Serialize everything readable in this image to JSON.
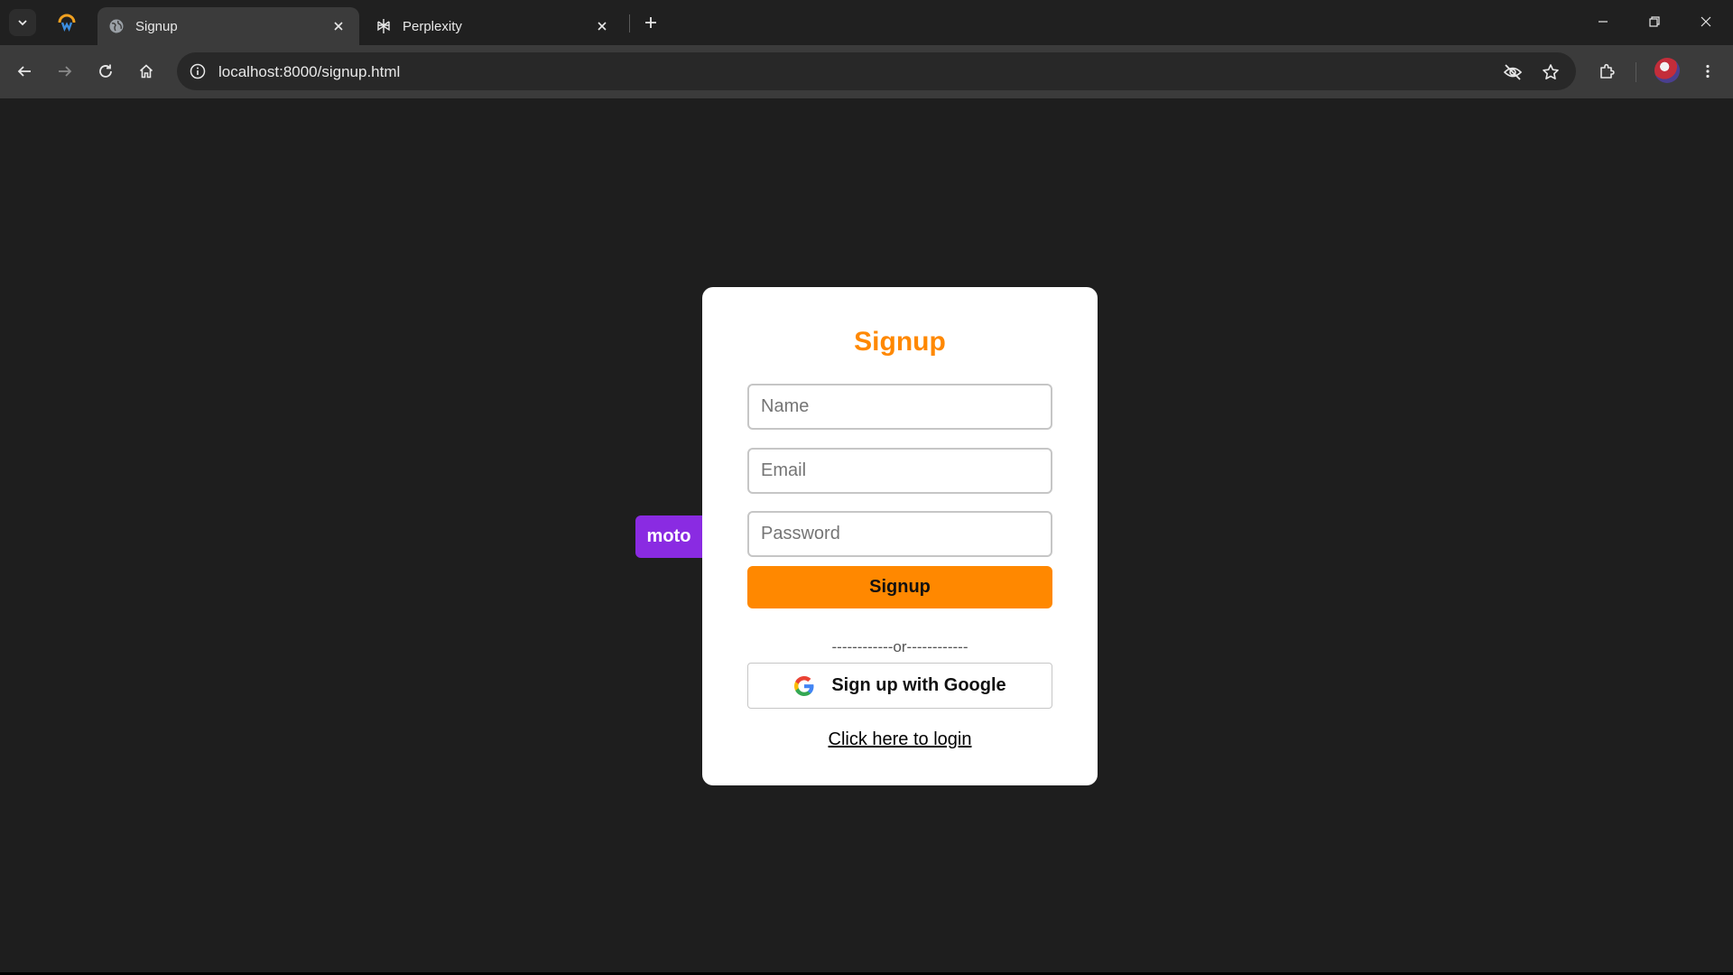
{
  "browser": {
    "tabs": [
      {
        "title": "Signup",
        "active": true
      },
      {
        "title": "Perplexity",
        "active": false
      }
    ],
    "url": "localhost:8000/signup.html"
  },
  "signup": {
    "title": "Signup",
    "name_placeholder": "Name",
    "email_placeholder": "Email",
    "password_placeholder": "Password",
    "submit_label": "Signup",
    "divider": "------------or------------",
    "google_label": "Sign up with Google",
    "login_link": "Click here to login"
  },
  "badge": {
    "label": "moto",
    "color": "#8a2be2"
  },
  "colors": {
    "accent": "#ff8800",
    "background": "#1e1e1e",
    "card": "#ffffff"
  }
}
